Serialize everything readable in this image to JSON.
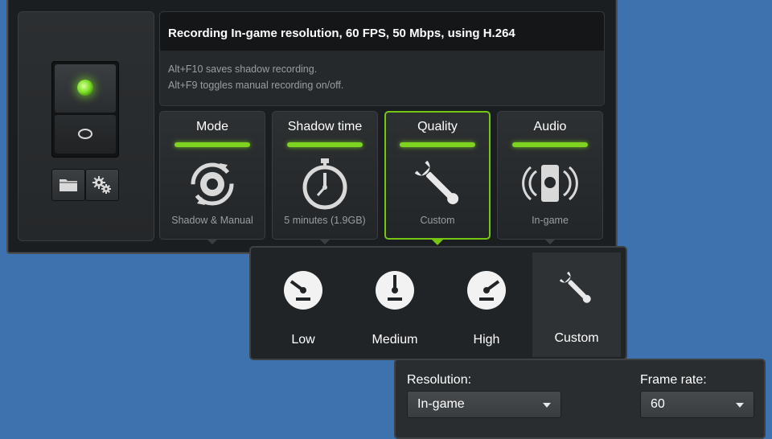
{
  "recording": {
    "summary": "Recording In-game resolution, 60 FPS, 50 Mbps, using H.264",
    "hint1": "Alt+F10 saves shadow recording.",
    "hint2": "Alt+F9 toggles manual recording on/off."
  },
  "switch": {
    "state": "on",
    "led_color": "#7ee22a"
  },
  "toolbar": {
    "folder_icon": "folder-icon",
    "settings_icon": "settings-gears-icon"
  },
  "tiles": [
    {
      "label": "Mode",
      "value": "Shadow & Manual",
      "icon": "shadow-manual-icon"
    },
    {
      "label": "Shadow time",
      "value": "5 minutes (1.9GB)",
      "icon": "stopwatch-icon"
    },
    {
      "label": "Quality",
      "value": "Custom",
      "icon": "wrench-icon",
      "selected": true
    },
    {
      "label": "Audio",
      "value": "In-game",
      "icon": "audio-device-icon"
    }
  ],
  "quality_options": [
    {
      "label": "Low",
      "icon": "gauge-low-icon"
    },
    {
      "label": "Medium",
      "icon": "gauge-medium-icon"
    },
    {
      "label": "High",
      "icon": "gauge-high-icon"
    },
    {
      "label": "Custom",
      "icon": "wrench-icon",
      "active": true
    }
  ],
  "custom": {
    "resolution_label": "Resolution:",
    "resolution_value": "In-game",
    "framerate_label": "Frame rate:",
    "framerate_value": "60"
  },
  "colors": {
    "accent_green": "#7ed321",
    "background_blue": "#3d72ae"
  }
}
